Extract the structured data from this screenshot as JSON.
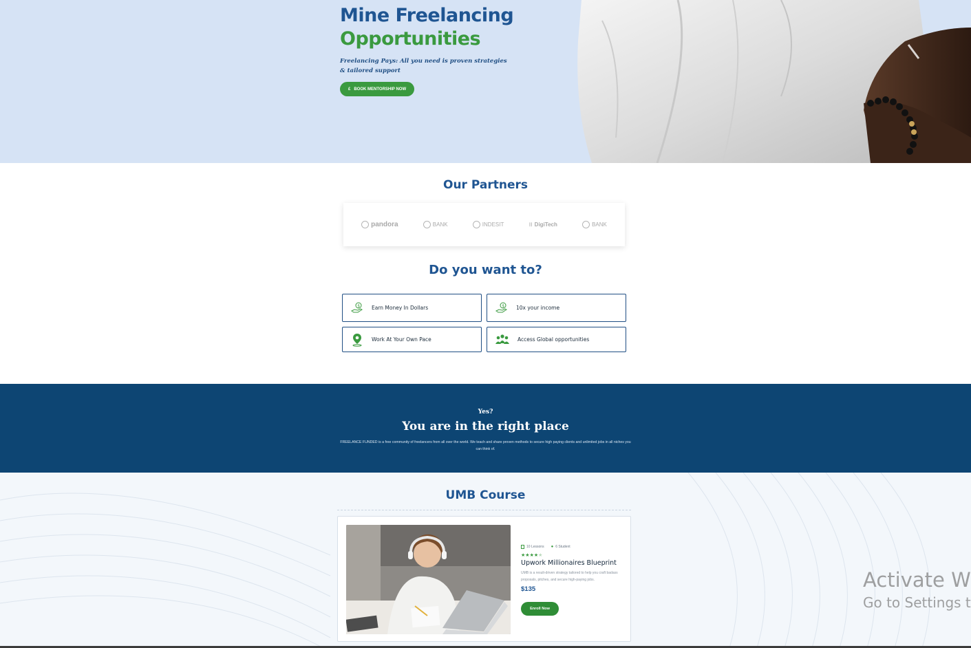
{
  "hero": {
    "title_line1": "Mine Freelancing",
    "title_line2": "Opportunities",
    "subtitle": "Freelancing Pays: All you need is proven strategies & tailored support",
    "cta_icon": "£",
    "cta_label": "BOOK MENTORSHIP NOW"
  },
  "partners": {
    "title": "Our Partners",
    "logos": [
      "pandora",
      "BANK",
      "INDESIT",
      "DigiTech",
      "BANK"
    ]
  },
  "want": {
    "title": "Do you want to?",
    "items": [
      {
        "label": "Earn Money In Dollars",
        "icon": "money-hand-icon"
      },
      {
        "label": "10x your income",
        "icon": "money-hand-icon"
      },
      {
        "label": "Work At Your Own Pace",
        "icon": "location-pin-icon"
      },
      {
        "label": "Access Global opportunities",
        "icon": "people-group-icon"
      }
    ]
  },
  "band": {
    "kicker": "Yes?",
    "title": "You are in the right place",
    "text": "FREELANCE FUNDED is a free community of freelancers from all over the world. We teach and share proven methods to secure high paying clients and unlimited jobs in all niches you can think of."
  },
  "course": {
    "section_title": "UMB Course",
    "lessons": "10 Lessons",
    "students": "6 Student",
    "rating": 4,
    "rating_max": 5,
    "name": "Upwork Millionaires Blueprint",
    "description": "UMB is a result-driven strategy tailored to help you craft badass proposals, pitches, and secure high-paying jobs.",
    "price": "$135",
    "enroll_label": "Enroll Now"
  },
  "watermark": {
    "line1": "Activate Win",
    "line2": "Go to Settings to"
  },
  "colors": {
    "hero_bg": "#d6e3f5",
    "brand_blue": "#1f5592",
    "brand_green": "#3a9a3f",
    "band_bg": "#0d4573"
  }
}
